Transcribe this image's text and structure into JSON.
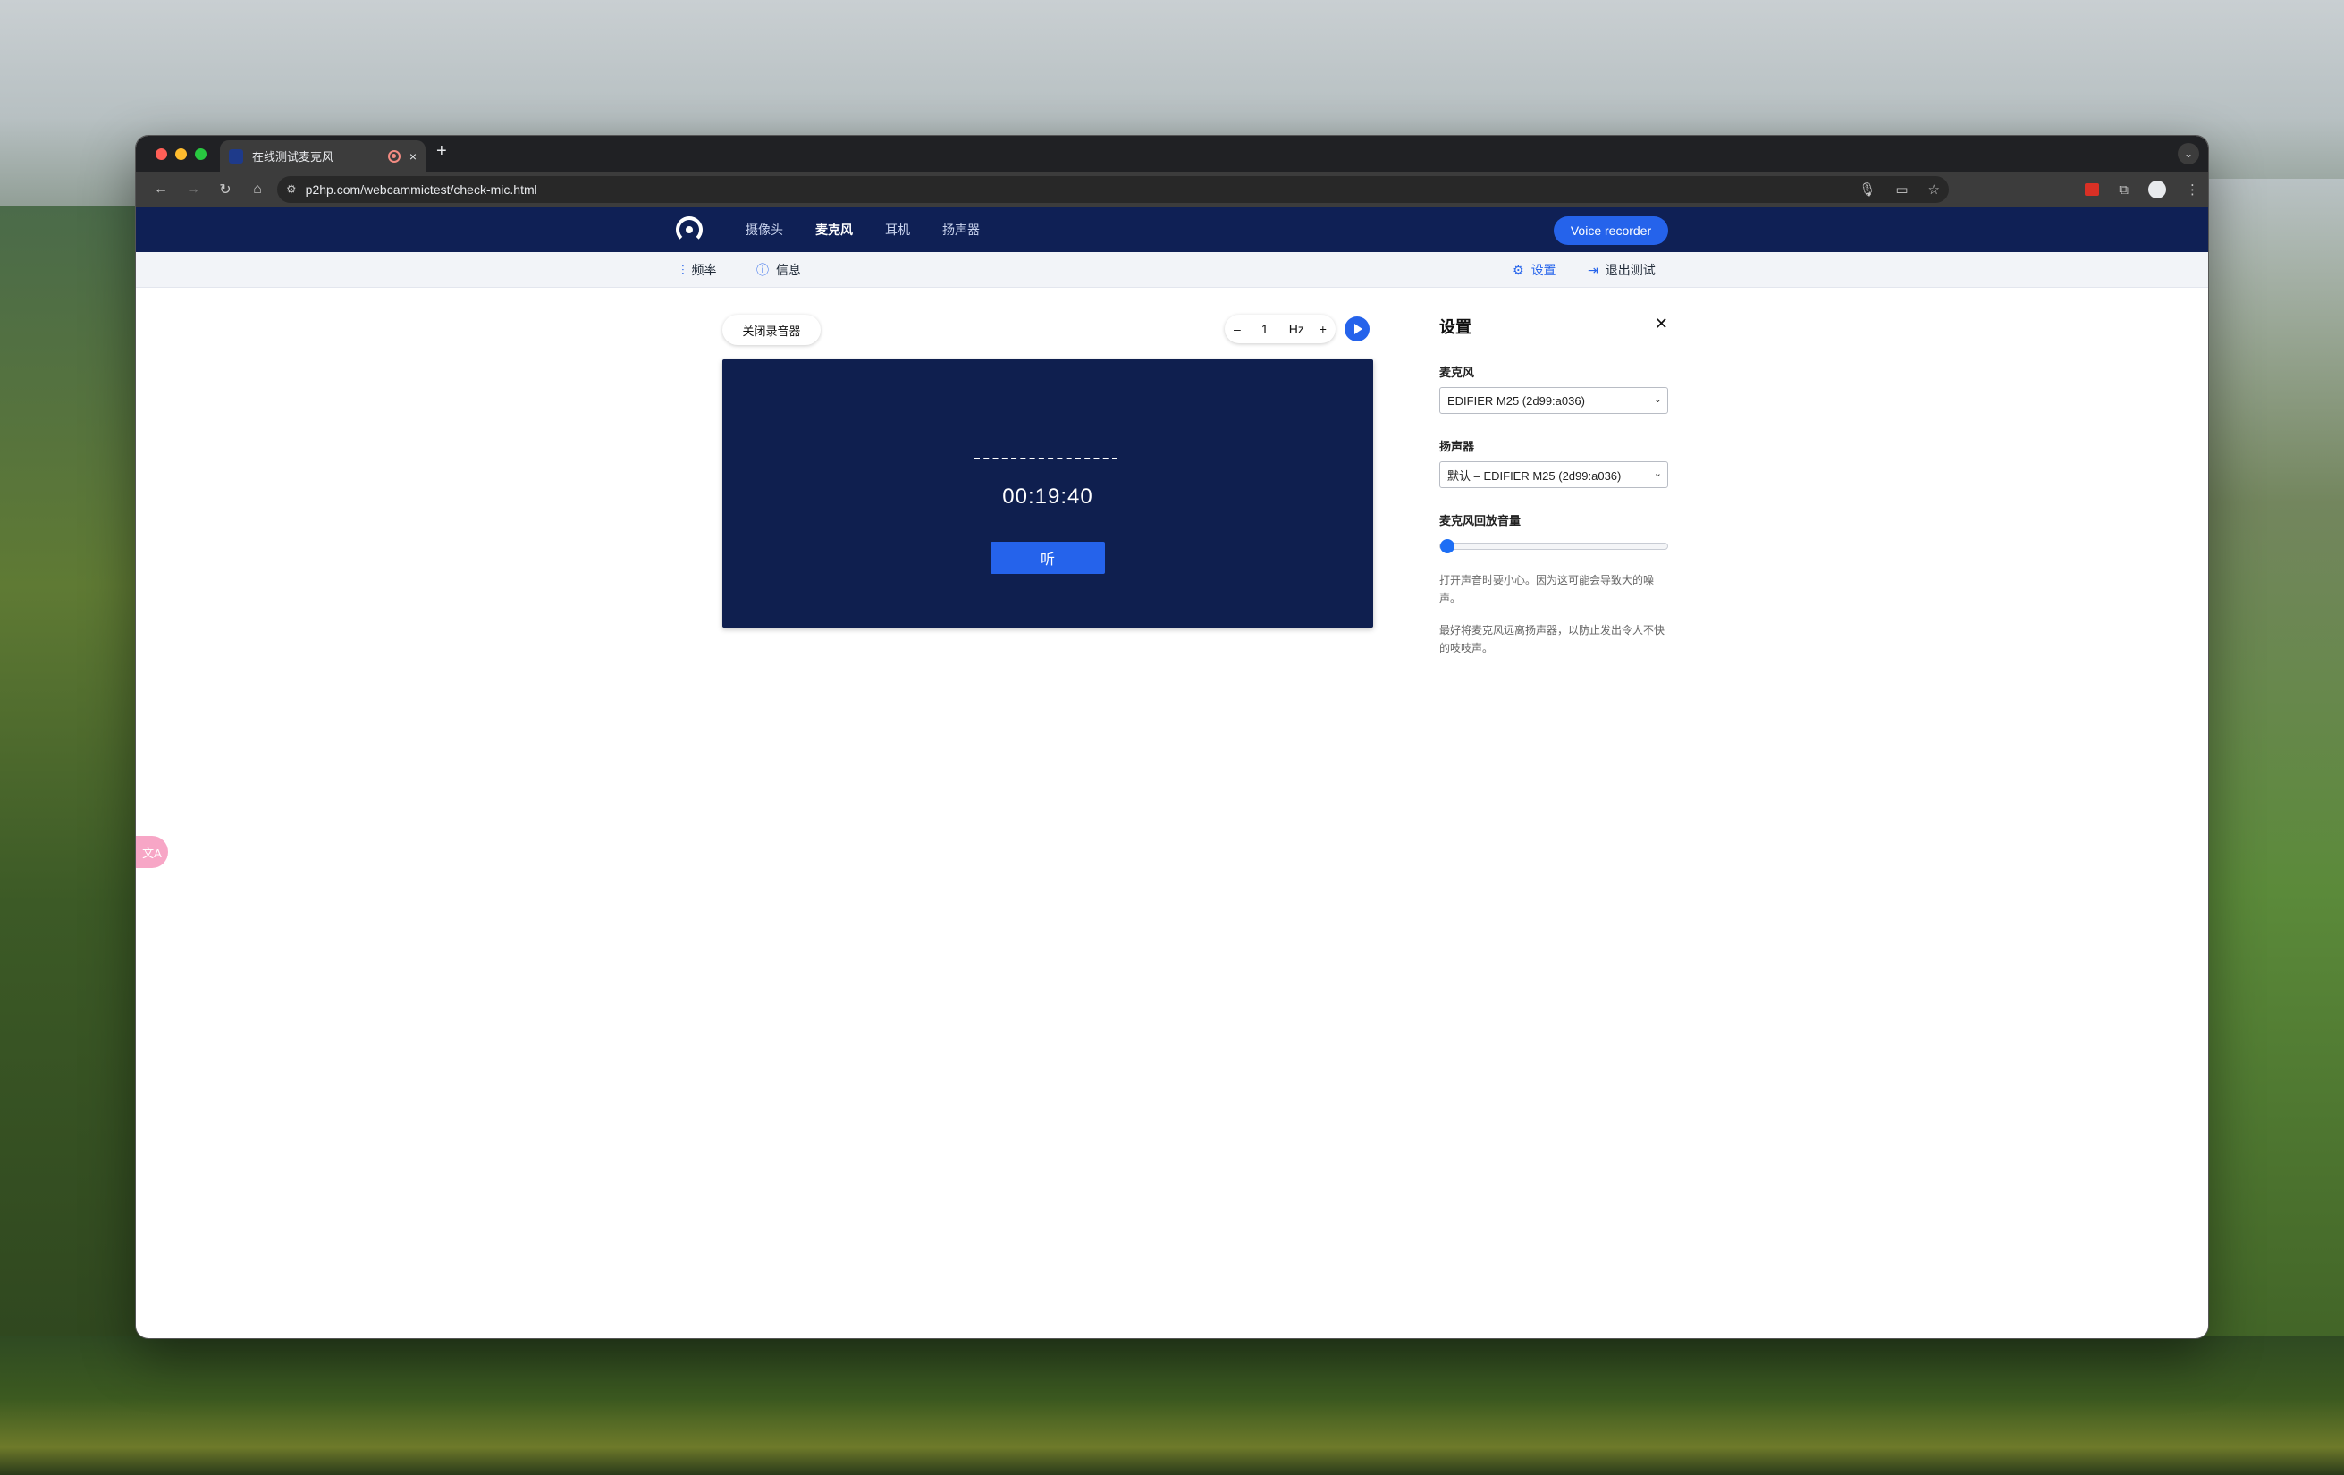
{
  "browser": {
    "tab_title": "在线测试麦克风",
    "url": "p2hp.com/webcammictest/check-mic.html",
    "new_tab_symbol": "+",
    "close_symbol": "×"
  },
  "site": {
    "nav": [
      "摄像头",
      "麦克风",
      "耳机",
      "扬声器"
    ],
    "active_nav": "麦克风",
    "voice_recorder_label": "Voice recorder"
  },
  "subnav": {
    "frequency_label": "频率",
    "info_label": "信息",
    "settings_label": "设置",
    "exit_label": "退出测试"
  },
  "recorder": {
    "close_button_label": "关闭录音器",
    "stepper_minus": "–",
    "stepper_value": "1",
    "stepper_unit": "Hz",
    "stepper_plus": "+",
    "timer": "00:19:40",
    "listen_label": "听"
  },
  "settings": {
    "title": "设置",
    "close_symbol": "✕",
    "mic_label": "麦克风",
    "mic_value": "EDIFIER M25 (2d99:a036)",
    "speaker_label": "扬声器",
    "speaker_value": "默认 – EDIFIER M25 (2d99:a036)",
    "playback_volume_label": "麦克风回放音量",
    "playback_volume": 0,
    "note1": "打开声音时要小心。因为这可能会导致大的噪声。",
    "note2": "最好将麦克风远离扬声器，以防止发出令人不快的吱吱声。"
  },
  "colors": {
    "site_header": "#0f2055",
    "accent": "#2563eb",
    "viz_background": "#0f1f4f"
  }
}
